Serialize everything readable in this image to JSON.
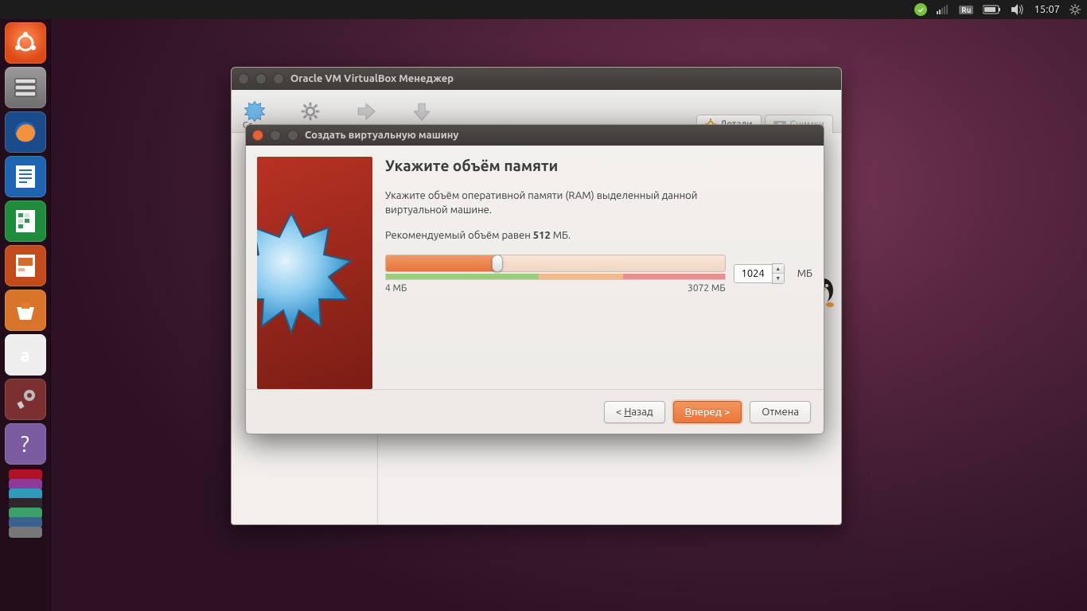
{
  "menubar": {
    "language": "Ru",
    "time": "15:07"
  },
  "main_window": {
    "title": "Oracle VM VirtualBox Менеджер",
    "toolbar_first_label": "Со",
    "tabs": {
      "details": "Детали",
      "snapshots": "Снимки"
    }
  },
  "wizard": {
    "title": "Создать виртуальную машину",
    "heading": "Укажите объём памяти",
    "description": "Укажите объём оперативной памяти (RAM) выделенный данной виртуальной машине.",
    "recommended_prefix": "Рекомендуемый объём равен ",
    "recommended_value": "512",
    "recommended_suffix": " МБ.",
    "slider": {
      "min_label": "4 МБ",
      "max_label": "3072 МБ",
      "value": "1024",
      "unit": "МБ"
    },
    "buttons": {
      "back": "< Назад",
      "next_prefix": "В",
      "next_rest": "перед >",
      "cancel": "Отмена"
    }
  }
}
